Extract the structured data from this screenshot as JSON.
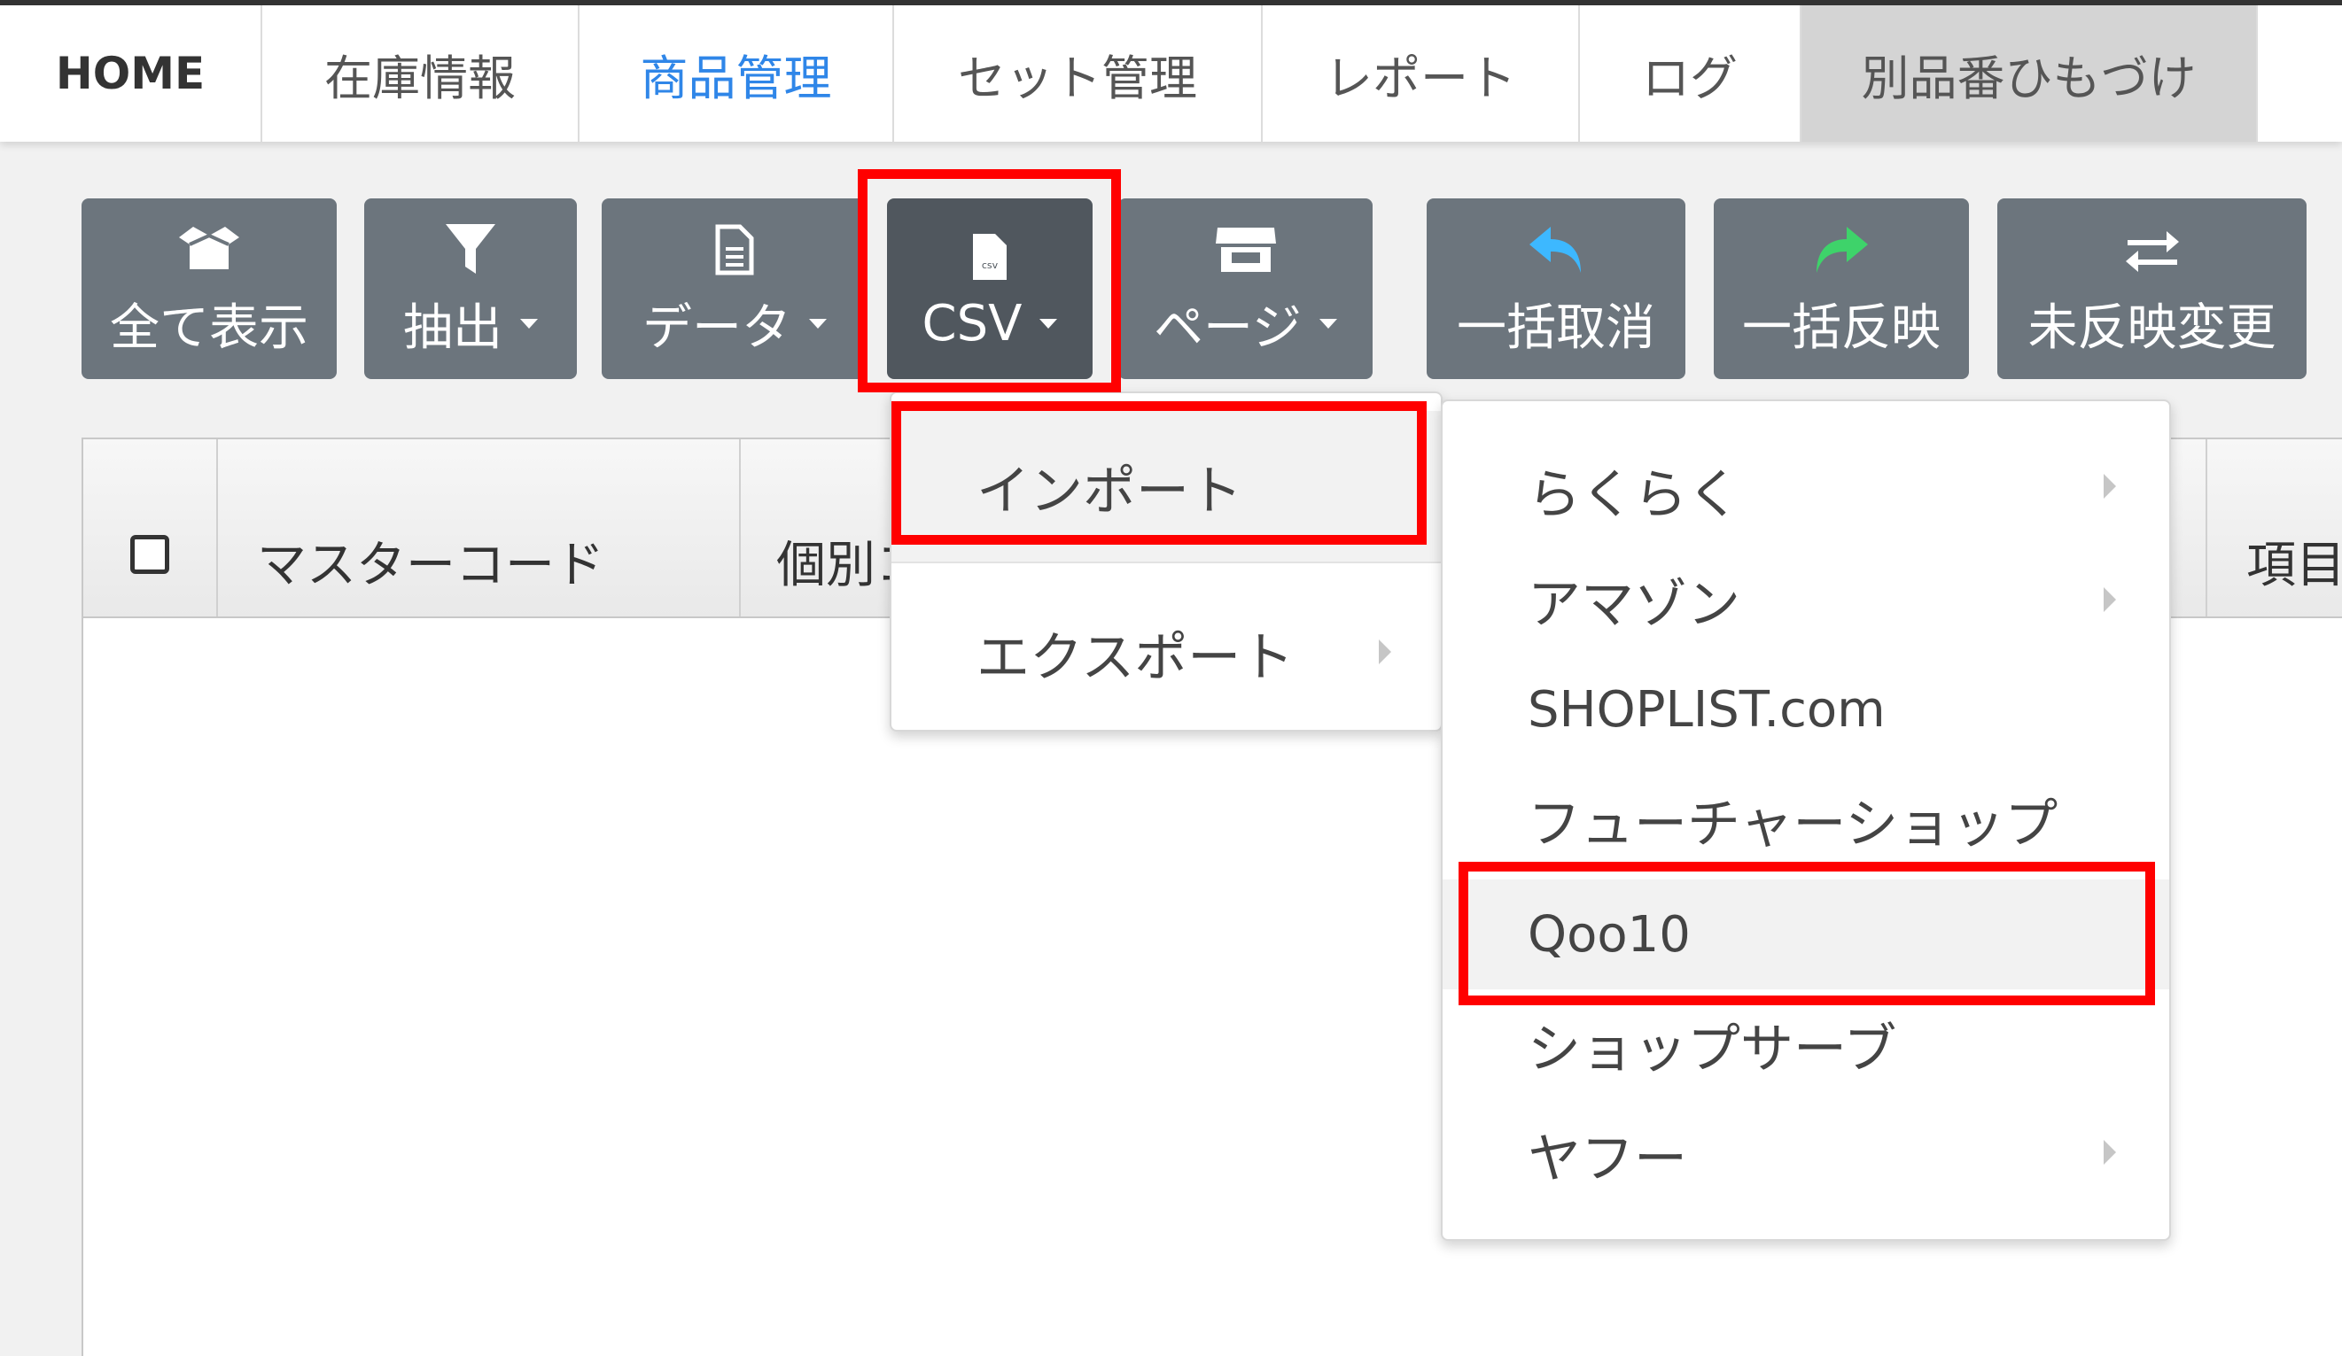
{
  "nav": {
    "tabs": [
      {
        "label": "HOME"
      },
      {
        "label": "在庫情報"
      },
      {
        "label": "商品管理"
      },
      {
        "label": "セット管理"
      },
      {
        "label": "レポート"
      },
      {
        "label": "ログ"
      },
      {
        "label": "別品番ひもづけ"
      }
    ],
    "active_tab": "商品管理",
    "selected_tab": "別品番ひもづけ"
  },
  "toolbar": {
    "buttons": [
      {
        "label": "全て表示",
        "icon": "box-open-icon"
      },
      {
        "label": "抽出",
        "icon": "filter-icon",
        "dropdown": true
      },
      {
        "label": "データ",
        "icon": "file-icon",
        "dropdown": true
      },
      {
        "label": "CSV",
        "icon": "csv-file-icon",
        "dropdown": true
      },
      {
        "label": "ページ",
        "icon": "store-icon",
        "dropdown": true
      },
      {
        "label": "一括取消",
        "icon": "undo-arrow-icon"
      },
      {
        "label": "一括反映",
        "icon": "redo-arrow-icon"
      },
      {
        "label": "未反映変更",
        "icon": "swap-arrows-icon"
      }
    ]
  },
  "table": {
    "headers": [
      "マスターコード",
      "個別コ",
      "項目"
    ]
  },
  "csv_menu": {
    "items": [
      {
        "label": "インポート"
      },
      {
        "label": "エクスポート",
        "has_submenu": true
      }
    ]
  },
  "import_submenu": {
    "items": [
      {
        "label": "らくらく",
        "has_submenu": true
      },
      {
        "label": "アマゾン",
        "has_submenu": true
      },
      {
        "label": "SHOPLIST.com"
      },
      {
        "label": "フューチャーショップ"
      },
      {
        "label": "Qoo10"
      },
      {
        "label": "ショップサーブ"
      },
      {
        "label": "ヤフー",
        "has_submenu": true
      }
    ]
  },
  "colors": {
    "button_bg": "#6c757d",
    "button_active_bg": "#50575e",
    "highlight_red": "#ff0000",
    "nav_active": "#2f86e8",
    "undo_icon": "#3db8ff",
    "redo_icon": "#3ed36a"
  }
}
